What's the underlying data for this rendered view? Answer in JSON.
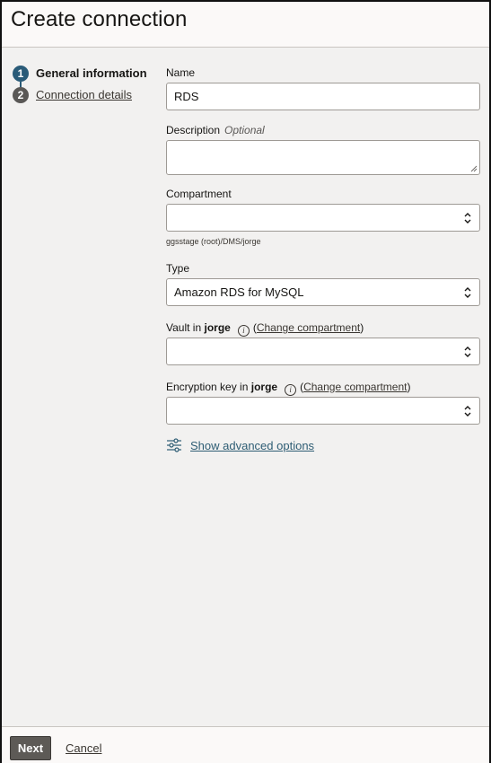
{
  "dialog": {
    "title": "Create connection"
  },
  "steps": [
    {
      "number": "1",
      "label": "General information"
    },
    {
      "number": "2",
      "label": "Connection details"
    }
  ],
  "form": {
    "name": {
      "label": "Name",
      "value": "RDS"
    },
    "description": {
      "label": "Description",
      "optional": "Optional",
      "value": ""
    },
    "compartment": {
      "label": "Compartment",
      "value": "",
      "help": "ggsstage (root)/DMS/jorge"
    },
    "type": {
      "label": "Type",
      "value": "Amazon RDS for MySQL"
    },
    "vault": {
      "label_prefix": "Vault in",
      "label_bold": "jorge",
      "change_link": "Change compartment",
      "paren_open": "(",
      "paren_close": ")",
      "info_icon": "info-icon",
      "value": ""
    },
    "encryption_key": {
      "label_prefix": "Encryption key in",
      "label_bold": "jorge",
      "change_link": "Change compartment",
      "paren_open": "(",
      "paren_close": ")",
      "info_icon": "info-icon",
      "value": ""
    },
    "advanced": {
      "label": "Show advanced options",
      "icon": "sliders-icon"
    }
  },
  "footer": {
    "next_label": "Next",
    "cancel_label": "Cancel"
  },
  "colors": {
    "step_active": "#2a5b78",
    "step_inactive": "#5a5856",
    "link_teal": "#2e5d74",
    "button_bg": "#5d5a56"
  }
}
